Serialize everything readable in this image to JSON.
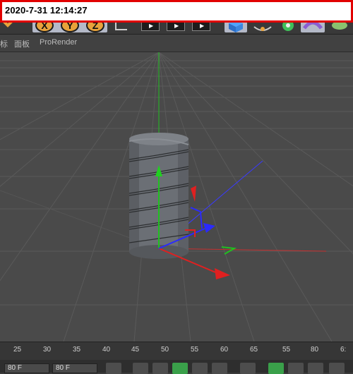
{
  "timestamp": "2020-7-31 12:14:27",
  "toolbar": {
    "coords": [
      {
        "label": "X"
      },
      {
        "label": "Y"
      },
      {
        "label": "Z"
      }
    ]
  },
  "menubar": {
    "items": [
      "标",
      "面板",
      "ProRender"
    ]
  },
  "timeline": {
    "ticks": [
      "25",
      "30",
      "35",
      "40",
      "45",
      "50",
      "55",
      "60",
      "65",
      "55",
      "80",
      "6:"
    ]
  },
  "transport": {
    "frame_a": "80 F",
    "frame_b": "80 F"
  },
  "colors": {
    "x_axis": "#e02020",
    "y_axis": "#20c020",
    "z_axis": "#2a2aff",
    "object": "#6b6f75"
  }
}
